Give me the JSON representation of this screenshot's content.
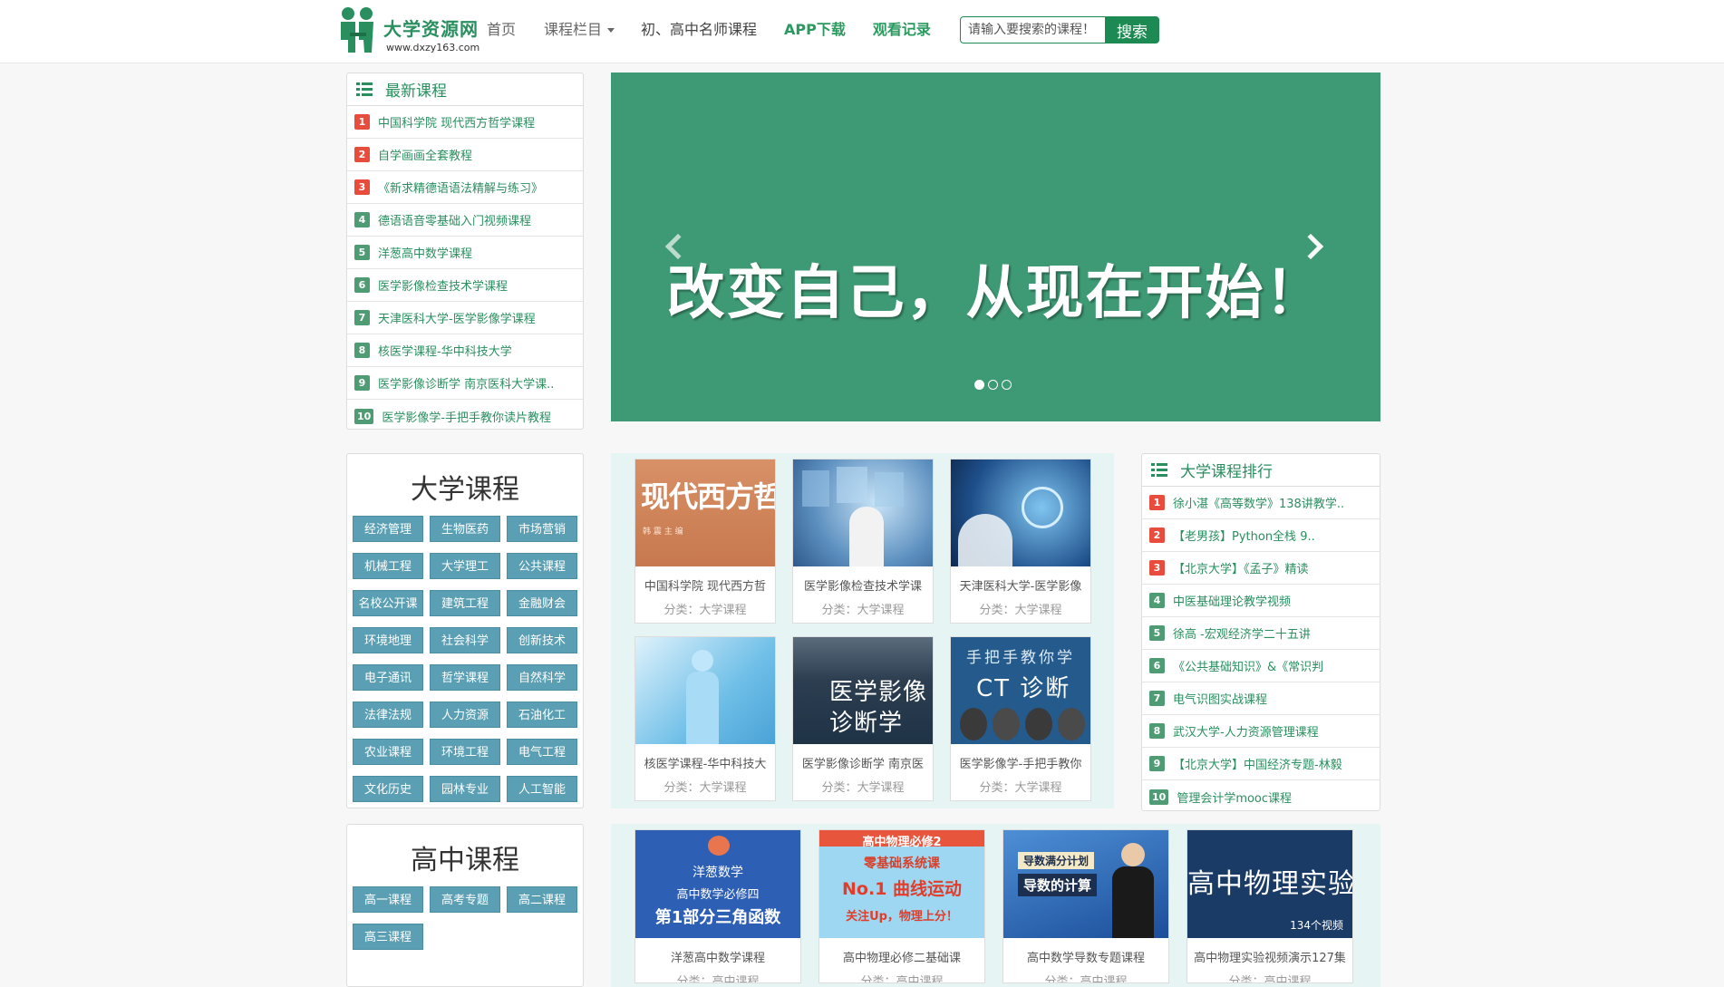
{
  "header": {
    "logo_title": "大学资源网",
    "logo_url": "www.dxzy163.com",
    "nav": [
      "首页",
      "课程栏目",
      "初、高中名师课程",
      "APP下载",
      "观看记录"
    ],
    "search_placeholder": "请输入要搜索的课程！",
    "search_button": "搜索"
  },
  "latest": {
    "title": "最新课程",
    "items": [
      {
        "n": "1",
        "text": "中国科学院 现代西方哲学课程"
      },
      {
        "n": "2",
        "text": "自学画画全套教程"
      },
      {
        "n": "3",
        "text": "《新求精德语语法精解与练习》"
      },
      {
        "n": "4",
        "text": "德语语音零基础入门视频课程"
      },
      {
        "n": "5",
        "text": "洋葱高中数学课程"
      },
      {
        "n": "6",
        "text": "医学影像检查技术学课程"
      },
      {
        "n": "7",
        "text": "天津医科大学-医学影像学课程"
      },
      {
        "n": "8",
        "text": "核医学课程-华中科技大学"
      },
      {
        "n": "9",
        "text": "医学影像诊断学 南京医科大学课.."
      },
      {
        "n": "10",
        "text": "医学影像学-手把手教你读片教程"
      }
    ]
  },
  "banner": {
    "text": "改变自己，从现在开始！",
    "color": "#3e9a74"
  },
  "university": {
    "title": "大学课程",
    "tags": [
      "经济管理",
      "生物医药",
      "市场营销",
      "机械工程",
      "大学理工",
      "公共课程",
      "名校公开课",
      "建筑工程",
      "金融财会",
      "环境地理",
      "社会科学",
      "创新技术",
      "电子通讯",
      "哲学课程",
      "自然科学",
      "法律法规",
      "人力资源",
      "石油化工",
      "农业课程",
      "环境工程",
      "电气工程",
      "文化历史",
      "园林专业",
      "人工智能"
    ]
  },
  "highschool": {
    "title": "高中课程",
    "tags": [
      "高一课程",
      "高考专题",
      "高二课程",
      "高三课程"
    ]
  },
  "uni_cards": [
    {
      "title": "中国科学院 现代西方哲",
      "cat": "分类：大学课程",
      "img_text": "现代西方哲学",
      "img_sub": "韩 震  主 编"
    },
    {
      "title": "医学影像检查技术学课",
      "cat": "分类：大学课程"
    },
    {
      "title": "天津医科大学-医学影像",
      "cat": "分类：大学课程"
    },
    {
      "title": "核医学课程-华中科技大",
      "cat": "分类：大学课程"
    },
    {
      "title": "医学影像诊断学 南京医",
      "cat": "分类：大学课程",
      "img_text": "医学影像诊断学"
    },
    {
      "title": "医学影像学-手把手教你",
      "cat": "分类：大学课程",
      "img_text": "手把手教你学",
      "img_text2": "CT 诊断"
    }
  ],
  "hs_cards": [
    {
      "title": "洋葱高中数学课程",
      "cat": "分类：高中课程",
      "img_l1": "洋葱数学",
      "img_l2": "高中数学必修四",
      "img_l3": "第1部分三角函数"
    },
    {
      "title": "高中物理必修二基础课",
      "cat": "分类：高中课程",
      "img_l1": "高中物理必修2",
      "img_l2": "零基础系统课",
      "img_l3": "No.1 曲线运动",
      "img_l4": "关注Up，物理上分！"
    },
    {
      "title": "高中数学导数专题课程",
      "cat": "分类：高中课程",
      "img_l1": "导数满分计划",
      "img_l2": "导数的计算"
    },
    {
      "title": "高中物理实验视频演示127集",
      "cat": "分类：高中课程",
      "img_l1": "高中物理实验",
      "img_l2": "134个视频"
    }
  ],
  "ranking": {
    "title": "大学课程排行",
    "items": [
      {
        "n": "1",
        "text": "徐小湛《高等数学》138讲教学.."
      },
      {
        "n": "2",
        "text": "【老男孩】Python全栈 9.."
      },
      {
        "n": "3",
        "text": "【北京大学】《孟子》精读"
      },
      {
        "n": "4",
        "text": "中医基础理论教学视频"
      },
      {
        "n": "5",
        "text": "徐高 -宏观经济学二十五讲"
      },
      {
        "n": "6",
        "text": "《公共基础知识》&《常识判"
      },
      {
        "n": "7",
        "text": "电气识图实战课程"
      },
      {
        "n": "8",
        "text": "武汉大学-人力资源管理课程"
      },
      {
        "n": "9",
        "text": "【北京大学】中国经济专题-林毅"
      },
      {
        "n": "10",
        "text": "管理会计学mooc课程"
      }
    ]
  }
}
